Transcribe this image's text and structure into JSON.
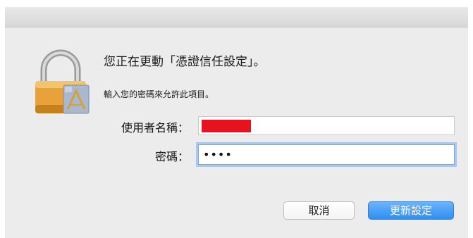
{
  "dialog": {
    "message": "您正在更動「憑證信任設定」。",
    "info": "輸入您的密碼來允許此項目。",
    "username_label": "使用者名稱：",
    "username_value": "",
    "password_label": "密碼：",
    "password_value": "••••",
    "cancel_label": "取消",
    "confirm_label": "更新設定"
  },
  "icons": {
    "lock": "lock-icon",
    "badge": "certificate-icon"
  },
  "colors": {
    "accent": "#2d8ff2",
    "redaction": "#e8121f",
    "focus_ring": "#a8c8f0"
  }
}
